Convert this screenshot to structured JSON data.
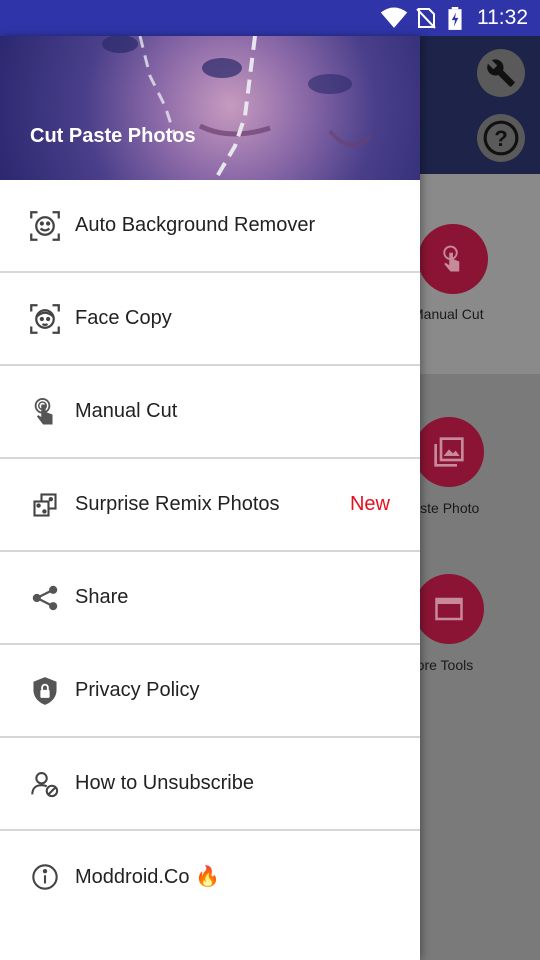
{
  "status_bar": {
    "time": "11:32"
  },
  "drawer": {
    "header_title": "Cut Paste Photos",
    "items": [
      {
        "label": "Auto Background Remover",
        "icon": "face-scan-icon"
      },
      {
        "label": "Face Copy",
        "icon": "face-copy-icon"
      },
      {
        "label": "Manual Cut",
        "icon": "touch-icon"
      },
      {
        "label": "Surprise Remix Photos",
        "icon": "dice-icon",
        "badge": "New"
      },
      {
        "label": "Share",
        "icon": "share-icon"
      },
      {
        "label": "Privacy Policy",
        "icon": "shield-lock-icon"
      },
      {
        "label": "How to Unsubscribe",
        "icon": "user-block-icon"
      },
      {
        "label": "Moddroid.Co 🔥",
        "icon": "info-icon"
      }
    ]
  },
  "background_app": {
    "tools": [
      {
        "label": "Manual Cut"
      },
      {
        "label": "Paste Photo"
      },
      {
        "label": "More Tools"
      }
    ]
  },
  "colors": {
    "accent_badge": "#e8101c",
    "tool_circle": "#c2185b",
    "status_bar": "#2f35a8"
  }
}
